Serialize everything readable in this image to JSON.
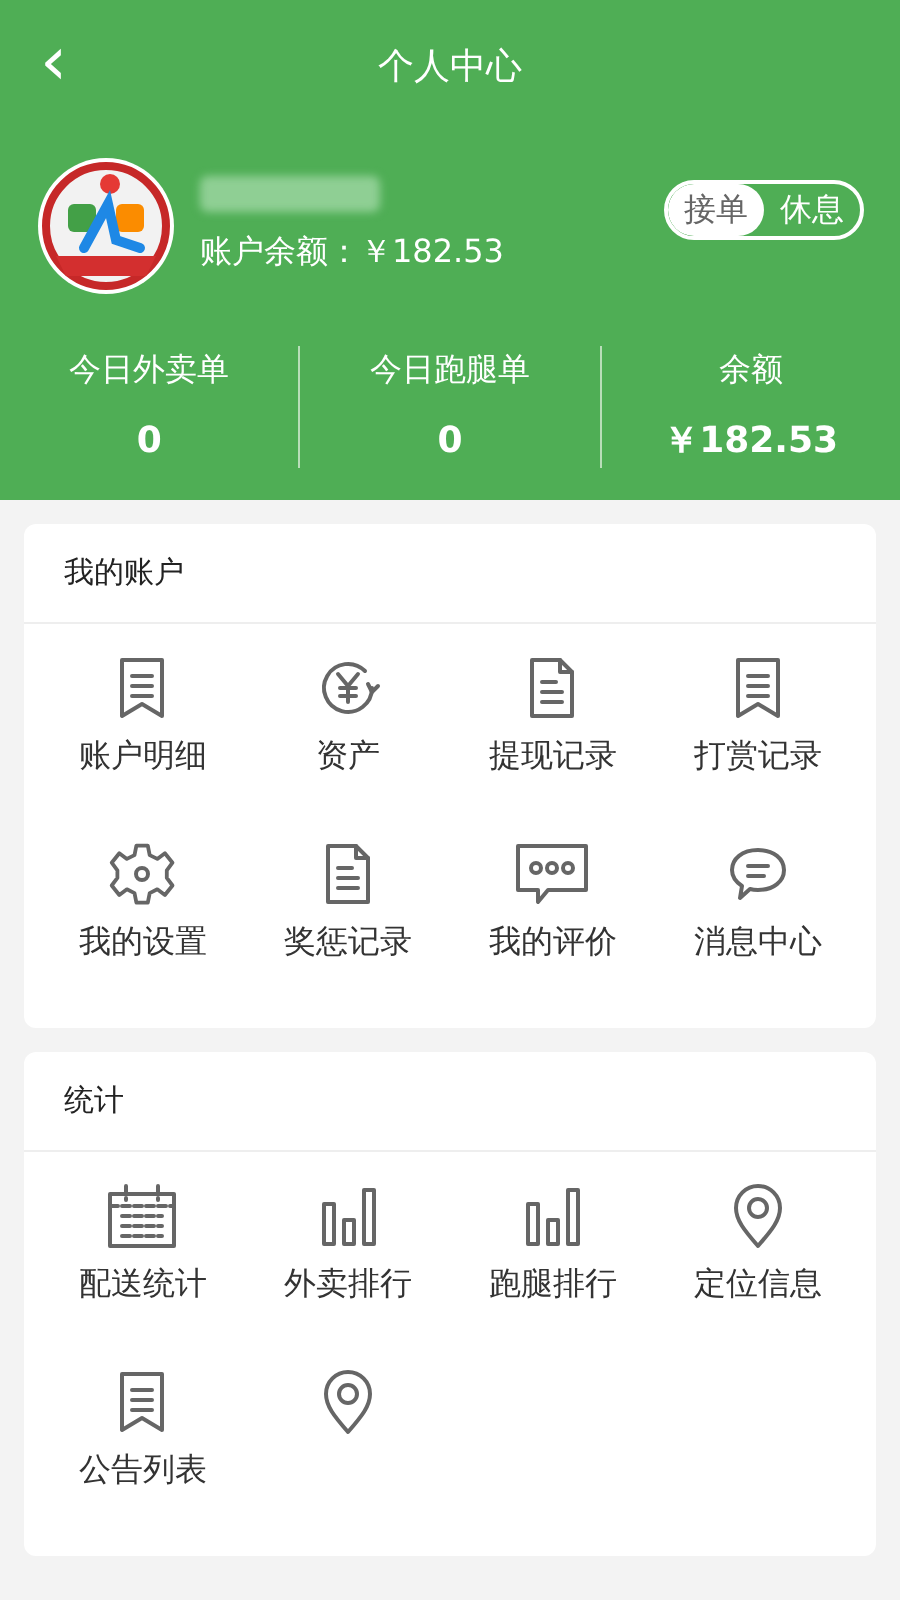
{
  "header": {
    "back_icon": "‹",
    "title": "个人中心"
  },
  "profile": {
    "balance_label": "账户余额：￥182.53",
    "status_toggle": [
      {
        "label": "接单",
        "selected": true
      },
      {
        "label": "休息",
        "selected": false
      }
    ]
  },
  "stats": [
    {
      "label": "今日外卖单",
      "value": "0"
    },
    {
      "label": "今日跑腿单",
      "value": "0"
    },
    {
      "label": "余额",
      "value": "￥182.53"
    }
  ],
  "sections": [
    {
      "title": "我的账户",
      "items": [
        {
          "kind": "receipt",
          "label": "账户明细"
        },
        {
          "kind": "yen",
          "label": "资产"
        },
        {
          "kind": "document",
          "label": "提现记录"
        },
        {
          "kind": "receipt",
          "label": "打赏记录"
        },
        {
          "kind": "gear",
          "label": "我的设置"
        },
        {
          "kind": "document",
          "label": "奖惩记录"
        },
        {
          "kind": "comment",
          "label": "我的评价"
        },
        {
          "kind": "chat",
          "label": "消息中心"
        }
      ]
    },
    {
      "title": "统计",
      "items": [
        {
          "kind": "calendar",
          "label": "配送统计"
        },
        {
          "kind": "bars",
          "label": "外卖排行"
        },
        {
          "kind": "bars",
          "label": "跑腿排行"
        },
        {
          "kind": "pin",
          "label": "定位信息"
        },
        {
          "kind": "receipt",
          "label": "公告列表"
        },
        {
          "kind": "pin"
        }
      ]
    }
  ]
}
